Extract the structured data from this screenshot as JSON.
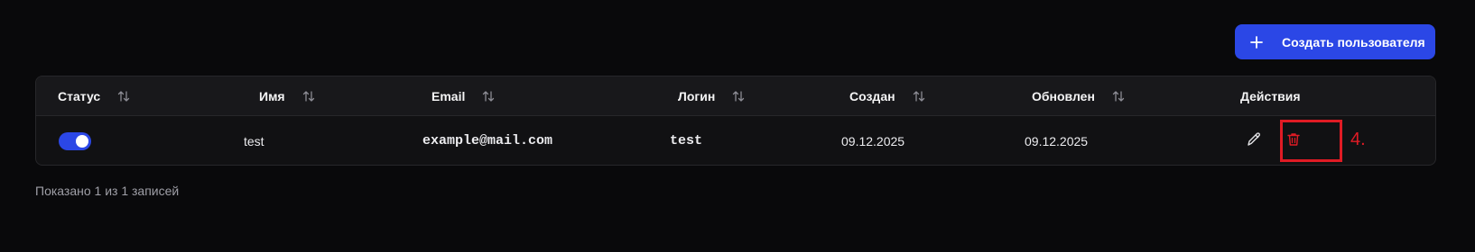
{
  "toolbar": {
    "create_user_label": "Создать пользователя"
  },
  "table": {
    "headers": {
      "status": "Статус",
      "name": "Имя",
      "email": "Email",
      "login": "Логин",
      "created": "Создан",
      "updated": "Обновлен",
      "actions": "Действия"
    },
    "rows": [
      {
        "status_active": true,
        "name": "test",
        "email": "example@mail.com",
        "login": "test",
        "created": "09.12.2025",
        "updated": "09.12.2025"
      }
    ]
  },
  "annotation": {
    "marker_label": "4."
  },
  "footer": {
    "summary": "Показано 1 из 1 записей"
  },
  "colors": {
    "accent": "#2b47e6",
    "danger": "#e01b24",
    "background": "#09090b"
  },
  "icons": {
    "create": "plus-icon",
    "sort": "sort-arrows-icon",
    "edit": "pencil-icon",
    "delete": "trash-icon"
  }
}
